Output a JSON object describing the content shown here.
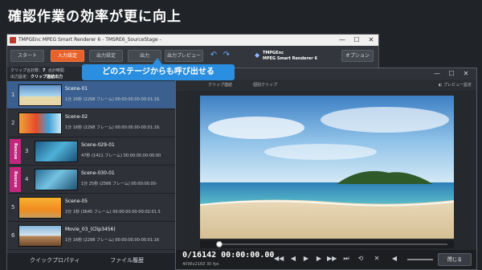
{
  "headline": "確認作業の効率が更に向上",
  "app": {
    "title": "TMPGEnc MPEG Smart Renderer 6 - TMSRE6_SourceStage -",
    "tabs": [
      "スタート",
      "入力設定",
      "出力設定",
      "出力",
      "出力プレビュー"
    ],
    "active_tab": "入力設定",
    "brand_line1": "TMPGEnc",
    "brand_line2": "MPEG Smart Renderer 6",
    "option_button": "オプション"
  },
  "info": {
    "clip_count_label": "クリップ合計数：",
    "clip_count": "7",
    "total_label": "合計時間",
    "output_label": "出力設定：",
    "output_value": "クリップ連結出力"
  },
  "clips": [
    {
      "index": "1",
      "name": "Scene-01",
      "info": "1分 16秒 (2298 フレーム)  00:00:00.00-00:01:16.",
      "rescue": false
    },
    {
      "index": "2",
      "name": "Scene-02",
      "info": "1分 16秒 (2298 フレーム)  00:00:00.00-00:01:16.",
      "rescue": false
    },
    {
      "index": "3",
      "name": "Scene-029-01",
      "info": "47秒 (1411 フレーム)  00:00:00.00-00:00",
      "rescue": true
    },
    {
      "index": "4",
      "name": "Scene-030-01",
      "info": "1分 25秒 (2566 フレーム)  00:00:00.00-",
      "rescue": true
    },
    {
      "index": "5",
      "name": "Scene-05",
      "info": "2分 1秒 (3645 フレーム)  00:00:00.00-00:02:01.5",
      "rescue": false
    },
    {
      "index": "6",
      "name": "Movie_03_(Clip3456)",
      "info": "1分 16秒 (2298 フレーム)  00:00:00.00-00:01:16",
      "rescue": false
    }
  ],
  "rescue_label": "Rescue",
  "bottom_tabs": [
    "クイックプロパティ",
    "ファイル履歴"
  ],
  "callout": "どのステージからも呼び出せる",
  "preview": {
    "toolbar_left": "クリップ連結",
    "toolbar_mid": "個別クリップ",
    "preset": "プレビュー設定",
    "timecode": "0/16142 00:00:00.00",
    "spec": "4096x2160 30 fps",
    "close": "閉じる",
    "position": 0
  }
}
